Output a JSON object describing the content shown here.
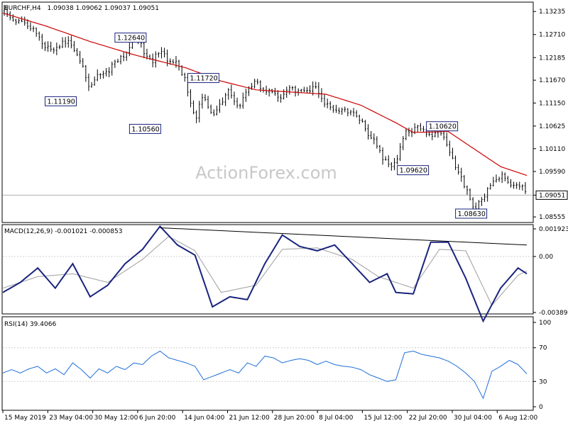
{
  "header": {
    "symbol": "EURCHF,H4",
    "ohlc": "1.09038 1.09062 1.09037 1.09051"
  },
  "watermark": "ActionForex.com",
  "colors": {
    "bull": "#000000",
    "bear": "#000000",
    "ma": "#cc0000",
    "macd_line": "#1a237e",
    "macd_signal": "#9e9e9e",
    "rsi": "#1e6fd9",
    "grid": "#d0d0d0",
    "label_border": "#1a237e"
  },
  "chart_data": [
    {
      "type": "candlestick",
      "title": "EURCHF,H4",
      "x_tick_labels": [
        "15 May 2019",
        "23 May 04:00",
        "30 May 12:00",
        "6 Jun 20:00",
        "14 Jun 04:00",
        "21 Jun 12:00",
        "28 Jun 20:00",
        "8 Jul 04:00",
        "15 Jul 12:00",
        "22 Jul 20:00",
        "30 Jul 04:00",
        "6 Aug 12:00"
      ],
      "y_tick_labels": [
        "1.13235",
        "1.12710",
        "1.12185",
        "1.11670",
        "1.11150",
        "1.10625",
        "1.10110",
        "1.09590",
        "1.09051",
        "1.08555"
      ],
      "ylim": [
        1.0846,
        1.134
      ],
      "current_price": "1.09051",
      "moving_average_color": "red",
      "key_level_labels": [
        {
          "label": "1.12640",
          "value": 1.1264
        },
        {
          "label": "1.11190",
          "value": 1.1119
        },
        {
          "label": "1.10560",
          "value": 1.1056
        },
        {
          "label": "1.11720",
          "value": 1.1172
        },
        {
          "label": "1.09620",
          "value": 1.0962
        },
        {
          "label": "1.10620",
          "value": 1.1062
        },
        {
          "label": "1.08630",
          "value": 1.0863
        }
      ],
      "price_path": [
        [
          0,
          1.1325
        ],
        [
          6,
          1.1302
        ],
        [
          12,
          1.1305
        ],
        [
          18,
          1.1282
        ],
        [
          24,
          1.1278
        ],
        [
          30,
          1.124
        ],
        [
          36,
          1.1228
        ],
        [
          42,
          1.1262
        ],
        [
          48,
          1.1238
        ],
        [
          54,
          1.121
        ],
        [
          60,
          1.115
        ],
        [
          66,
          1.1185
        ],
        [
          72,
          1.1192
        ],
        [
          78,
          1.1205
        ],
        [
          84,
          1.123
        ],
        [
          90,
          1.1264
        ],
        [
          96,
          1.124
        ],
        [
          102,
          1.1212
        ],
        [
          108,
          1.1225
        ],
        [
          114,
          1.1218
        ],
        [
          120,
          1.1198
        ],
        [
          126,
          1.116
        ],
        [
          132,
          1.1082
        ],
        [
          138,
          1.1128
        ],
        [
          144,
          1.1088
        ],
        [
          150,
          1.1112
        ],
        [
          156,
          1.1142
        ],
        [
          162,
          1.1108
        ],
        [
          168,
          1.1138
        ],
        [
          174,
          1.1172
        ],
        [
          180,
          1.1135
        ],
        [
          186,
          1.114
        ],
        [
          192,
          1.1132
        ],
        [
          198,
          1.1145
        ],
        [
          204,
          1.115
        ],
        [
          210,
          1.1138
        ],
        [
          216,
          1.1152
        ],
        [
          222,
          1.111
        ],
        [
          228,
          1.1092
        ],
        [
          234,
          1.1108
        ],
        [
          240,
          1.1088
        ],
        [
          246,
          1.108
        ],
        [
          252,
          1.104
        ],
        [
          258,
          1.1008
        ],
        [
          264,
          1.0982
        ],
        [
          270,
          1.0972
        ],
        [
          276,
          1.1052
        ],
        [
          282,
          1.1058
        ],
        [
          288,
          1.1052
        ],
        [
          294,
          1.1045
        ],
        [
          300,
          1.1048
        ],
        [
          306,
          1.1018
        ],
        [
          312,
          1.0962
        ],
        [
          318,
          1.0915
        ],
        [
          324,
          1.0878
        ],
        [
          330,
          1.089
        ],
        [
          336,
          1.0935
        ],
        [
          342,
          1.0948
        ],
        [
          348,
          1.093
        ],
        [
          354,
          1.0935
        ],
        [
          360,
          1.0905
        ]
      ],
      "ma_path": [
        [
          0,
          1.132
        ],
        [
          30,
          1.129
        ],
        [
          60,
          1.1255
        ],
        [
          90,
          1.1225
        ],
        [
          108,
          1.121
        ],
        [
          126,
          1.1195
        ],
        [
          150,
          1.1165
        ],
        [
          174,
          1.1145
        ],
        [
          198,
          1.114
        ],
        [
          222,
          1.1135
        ],
        [
          246,
          1.111
        ],
        [
          270,
          1.107
        ],
        [
          282,
          1.1048
        ],
        [
          306,
          1.105
        ],
        [
          324,
          1.101
        ],
        [
          342,
          1.097
        ],
        [
          360,
          1.095
        ]
      ]
    },
    {
      "type": "line",
      "title": "MACD(12,26,9) -0.001021 -0.000853",
      "name": "MACD(12,26,9)",
      "values_shown": [
        "-0.001021",
        "-0.000853"
      ],
      "y_tick_labels": [
        "0.001923",
        "0.00",
        "-0.003896"
      ],
      "ylim": [
        -0.003896,
        0.001923
      ],
      "macd_path": [
        [
          0,
          -0.0025
        ],
        [
          12,
          -0.0018
        ],
        [
          24,
          -0.0008
        ],
        [
          36,
          -0.0022
        ],
        [
          48,
          -0.0005
        ],
        [
          60,
          -0.0028
        ],
        [
          72,
          -0.002
        ],
        [
          84,
          -0.0005
        ],
        [
          96,
          0.0005
        ],
        [
          108,
          0.0021
        ],
        [
          120,
          0.0008
        ],
        [
          132,
          0.0001
        ],
        [
          144,
          -0.0035
        ],
        [
          156,
          -0.0028
        ],
        [
          168,
          -0.003
        ],
        [
          180,
          -0.0005
        ],
        [
          192,
          0.0015
        ],
        [
          204,
          0.0007
        ],
        [
          216,
          0.0004
        ],
        [
          228,
          0.0008
        ],
        [
          240,
          -0.0005
        ],
        [
          252,
          -0.0018
        ],
        [
          264,
          -0.0012
        ],
        [
          270,
          -0.0025
        ],
        [
          282,
          -0.0026
        ],
        [
          294,
          0.001
        ],
        [
          306,
          0.001
        ],
        [
          318,
          -0.0015
        ],
        [
          330,
          -0.0045
        ],
        [
          342,
          -0.0022
        ],
        [
          354,
          -0.0008
        ],
        [
          360,
          -0.0012
        ]
      ],
      "signal_path": [
        [
          0,
          -0.0022
        ],
        [
          24,
          -0.0014
        ],
        [
          48,
          -0.0012
        ],
        [
          72,
          -0.0018
        ],
        [
          96,
          -0.0002
        ],
        [
          114,
          0.0014
        ],
        [
          132,
          0.0004
        ],
        [
          150,
          -0.0025
        ],
        [
          174,
          -0.002
        ],
        [
          192,
          0.0005
        ],
        [
          216,
          0.0006
        ],
        [
          240,
          -0.0002
        ],
        [
          258,
          -0.0014
        ],
        [
          282,
          -0.0022
        ],
        [
          300,
          0.0005
        ],
        [
          318,
          0.0004
        ],
        [
          336,
          -0.0034
        ],
        [
          354,
          -0.0013
        ],
        [
          360,
          -0.001
        ]
      ],
      "divergence_line": [
        [
          108,
          0.002
        ],
        [
          360,
          0.0008
        ]
      ]
    },
    {
      "type": "line",
      "title": "RSI(14) 39.4066",
      "name": "RSI(14)",
      "value_shown": "39.4066",
      "y_tick_labels": [
        "100",
        "70",
        "30",
        "0"
      ],
      "ylim": [
        0,
        100
      ],
      "reference_levels": [
        70,
        30
      ],
      "rsi_path": [
        [
          0,
          40
        ],
        [
          6,
          44
        ],
        [
          12,
          40
        ],
        [
          18,
          45
        ],
        [
          24,
          48
        ],
        [
          30,
          40
        ],
        [
          36,
          45
        ],
        [
          42,
          38
        ],
        [
          48,
          52
        ],
        [
          54,
          44
        ],
        [
          60,
          34
        ],
        [
          66,
          45
        ],
        [
          72,
          40
        ],
        [
          78,
          48
        ],
        [
          84,
          44
        ],
        [
          90,
          52
        ],
        [
          96,
          50
        ],
        [
          102,
          60
        ],
        [
          108,
          66
        ],
        [
          114,
          58
        ],
        [
          120,
          55
        ],
        [
          126,
          52
        ],
        [
          132,
          48
        ],
        [
          138,
          32
        ],
        [
          144,
          36
        ],
        [
          150,
          40
        ],
        [
          156,
          44
        ],
        [
          162,
          40
        ],
        [
          168,
          52
        ],
        [
          174,
          48
        ],
        [
          180,
          60
        ],
        [
          186,
          58
        ],
        [
          192,
          52
        ],
        [
          198,
          55
        ],
        [
          204,
          57
        ],
        [
          210,
          55
        ],
        [
          216,
          50
        ],
        [
          222,
          54
        ],
        [
          228,
          50
        ],
        [
          234,
          48
        ],
        [
          240,
          47
        ],
        [
          246,
          44
        ],
        [
          252,
          38
        ],
        [
          258,
          34
        ],
        [
          264,
          30
        ],
        [
          270,
          32
        ],
        [
          276,
          64
        ],
        [
          282,
          66
        ],
        [
          288,
          62
        ],
        [
          294,
          60
        ],
        [
          300,
          58
        ],
        [
          306,
          54
        ],
        [
          312,
          48
        ],
        [
          318,
          40
        ],
        [
          324,
          30
        ],
        [
          330,
          10
        ],
        [
          336,
          42
        ],
        [
          342,
          48
        ],
        [
          348,
          55
        ],
        [
          354,
          50
        ],
        [
          360,
          39
        ]
      ]
    }
  ]
}
